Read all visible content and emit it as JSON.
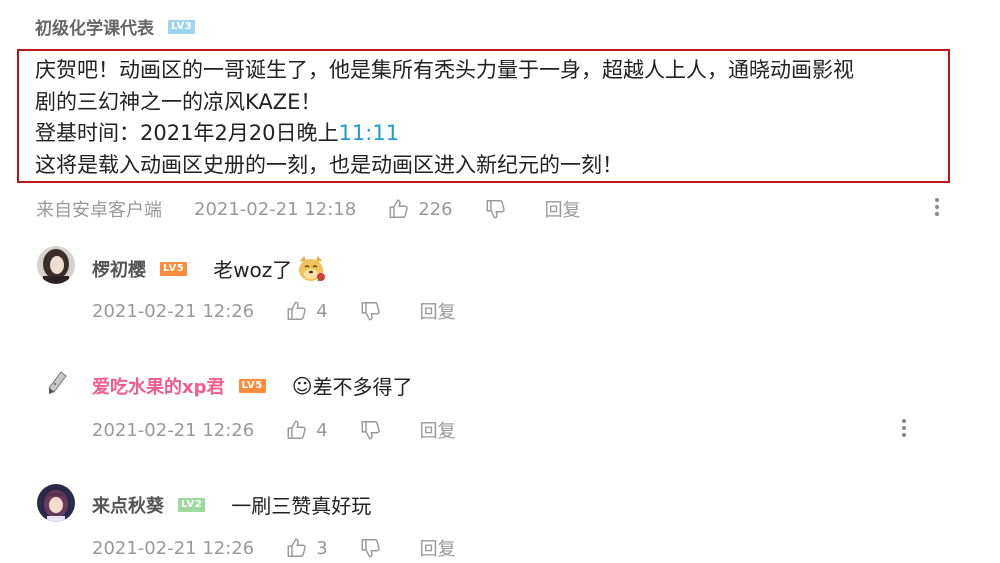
{
  "main_comment": {
    "author": "初级化学课代表",
    "level": "LV3",
    "lines": [
      "庆贺吧！动画区的一哥诞生了，他是集所有秃头力量于一身，超越人上人，通晓动画影视",
      "剧的三幻神之一的凉风KAZE！",
      "登基时间：2021年2月20日晚上"
    ],
    "time_link": "11:11",
    "last_line": "这将是载入动画区史册的一刻，也是动画区进入新纪元的一刻！",
    "source": "来自安卓客户端",
    "date": "2021-02-21 12:18",
    "likes": "226",
    "reply_label": "回复"
  },
  "replies": [
    {
      "username": "椤初樱",
      "level": "LV5",
      "text": "老woz了",
      "date": "2021-02-21 12:26",
      "likes": "4",
      "reply_label": "回复"
    },
    {
      "username": "爱吃水果的xp君",
      "level": "LV5",
      "text": "差不多得了",
      "emoji": "☺",
      "date": "2021-02-21 12:26",
      "likes": "4",
      "reply_label": "回复"
    },
    {
      "username": "来点秋葵",
      "level": "LV2",
      "text": "一刷三赞真好玩",
      "date": "2021-02-21 12:26",
      "likes": "3",
      "reply_label": "回复"
    }
  ],
  "colors": {
    "highlight_border": "#b8161d",
    "link": "#1d9bd3",
    "pink_name": "#f25d8e",
    "meta_gray": "#999999"
  }
}
